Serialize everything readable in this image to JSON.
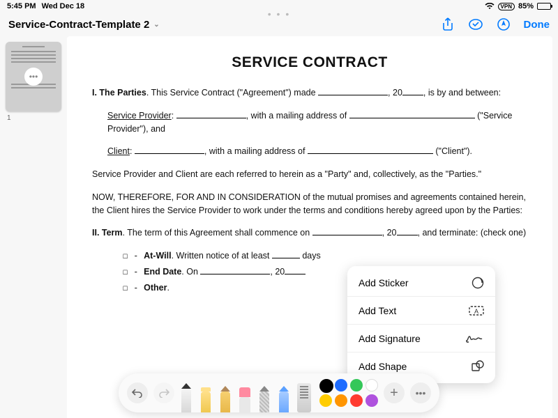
{
  "status": {
    "time": "5:45 PM",
    "date": "Wed Dec 18",
    "vpn": "VPN",
    "battery_pct": "85%"
  },
  "toolbar": {
    "title": "Service-Contract-Template 2",
    "done": "Done"
  },
  "sidebar": {
    "page_number": "1"
  },
  "doc": {
    "title": "SERVICE CONTRACT",
    "p1a": "I. The Parties",
    "p1b": ". This Service Contract (\"Agreement\") made ",
    "p1c": ", 20",
    "p1d": ", is by and between:",
    "sp_label": "Service Provider",
    "sp_a": ", with a mailing address of ",
    "sp_b": " (\"Service Provider\"), and",
    "cl_label": "Client",
    "cl_a": ", with a mailing address of ",
    "cl_b": " (\"Client\").",
    "p3": "Service Provider and Client are each referred to herein as a \"Party\" and, collectively, as the \"Parties.\"",
    "p4": "NOW, THEREFORE, FOR AND IN CONSIDERATION of the mutual promises and agreements contained herein, the Client hires the Service Provider to work under the terms and conditions hereby agreed upon by the Parties:",
    "term_a": "II. Term",
    "term_b": ". The term of this Agreement shall commence on ",
    "term_c": ", 20",
    "term_d": ", and terminate: (check one)",
    "opt1a": "☐ - ",
    "opt1b": "At-Will",
    "opt1c": ". Written notice of at least ",
    "opt1d": " days",
    "opt2a": "☐ - ",
    "opt2b": "End Date",
    "opt2c": ". On ",
    "opt2d": ", 20",
    "opt3a": "☐ - ",
    "opt3b": "Other",
    "opt3c": ". "
  },
  "popover": {
    "sticker": "Add Sticker",
    "text": "Add Text",
    "signature": "Add Signature",
    "shape": "Add Shape"
  },
  "colors": {
    "accent": "#007aff",
    "black": "#000000",
    "blue": "#1e6cff",
    "green": "#34c759",
    "yellow": "#ffcc00",
    "orange": "#ff9500",
    "red": "#ff3b30",
    "purple": "#af52de"
  }
}
